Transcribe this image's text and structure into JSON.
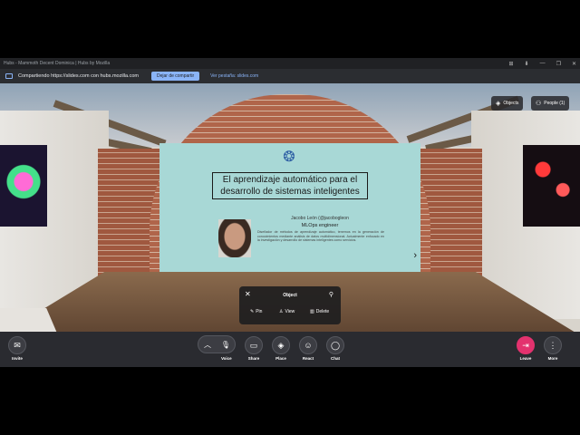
{
  "window": {
    "title": "Hubs - Mammoth Decent Dominica | Hubs by Mozilla",
    "controls": [
      "⊞",
      "⬇",
      "—",
      "❐",
      "✕"
    ]
  },
  "share_bar": {
    "text": "Compartiendo https://slides.com con hubs.mozilla.com",
    "stop_label": "Dejar de compartir",
    "view_label": "Ver pestaña: slides.com"
  },
  "top_right": {
    "objects_label": "Objects",
    "people_label": "People (1)"
  },
  "slide": {
    "title_line1": "El aprendizaje automático para el",
    "title_line2": "desarrollo de sistemas inteligentes",
    "name": "Jacobo León (@jacobogleon",
    "role": "MLOps engineer",
    "bio": "Diseñador de métodos de aprendizaje automático, tenemos en la generación de conocimientos mediante análisis de datos multidimensional. Actualmente enfocado en la investigación y desarrollo de sistemas inteligentes como servicios."
  },
  "object_menu": {
    "title": "Object",
    "pin_label": "Pin",
    "view_label": "View",
    "delete_label": "Delete"
  },
  "footer": {
    "invite_label": "Invite",
    "voice_label": "Voice",
    "share_label": "Share",
    "place_label": "Place",
    "react_label": "React",
    "chat_label": "Chat",
    "leave_label": "Leave",
    "more_label": "More"
  },
  "colors": {
    "slide_bg": "#a8d8d6",
    "leave_accent": "#e3326e",
    "stop_button": "#8ab4f8"
  }
}
